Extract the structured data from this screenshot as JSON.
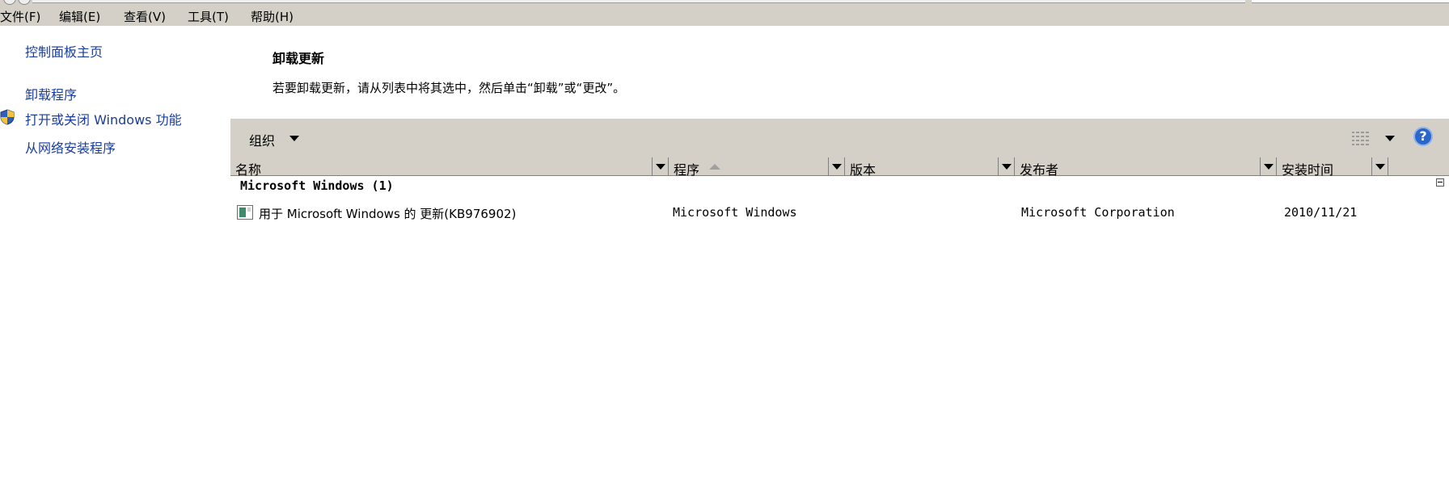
{
  "menubar": {
    "file": "文件(F)",
    "edit": "编辑(E)",
    "view": "查看(V)",
    "tools": "工具(T)",
    "help": "帮助(H)"
  },
  "sidebar": {
    "home": "控制面板主页",
    "uninstall": "卸载程序",
    "features": "打开或关闭 Windows 功能",
    "network_install": "从网络安装程序"
  },
  "content": {
    "title": "卸载更新",
    "description": "若要卸载更新，请从列表中将其选中，然后单击“卸载”或“更改”。"
  },
  "toolbar": {
    "organize": "组织",
    "help_symbol": "?"
  },
  "columns": {
    "name": "名称",
    "program": "程序",
    "version": "版本",
    "publisher": "发布者",
    "installed": "安装时间"
  },
  "list": {
    "group": "Microsoft Windows (1)",
    "rows": [
      {
        "name": "用于 Microsoft Windows 的 更新(KB976902)",
        "program": "Microsoft Windows",
        "version": "",
        "publisher": "Microsoft Corporation",
        "installed": "2010/11/21"
      }
    ]
  },
  "colors": {
    "chrome": "#d4d0c8",
    "link": "#1a3d9c"
  }
}
